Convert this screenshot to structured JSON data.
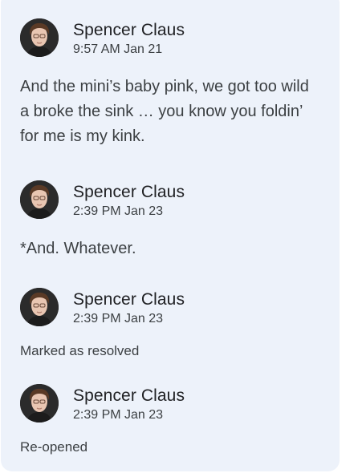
{
  "comments": [
    {
      "author": "Spencer Claus",
      "timestamp": "9:57 AM Jan 21",
      "body": "And the mini’s baby pink, we got too wild a broke the sink … you know you foldin’ for me is my kink."
    },
    {
      "author": "Spencer Claus",
      "timestamp": "2:39 PM Jan 23",
      "body": "*And. Whatever."
    },
    {
      "author": "Spencer Claus",
      "timestamp": "2:39 PM Jan 23",
      "status": "Marked as resolved"
    },
    {
      "author": "Spencer Claus",
      "timestamp": "2:39 PM Jan 23",
      "status": "Re-opened"
    }
  ],
  "colors": {
    "panel_background": "#edf2fa",
    "author_text": "#202124",
    "body_text": "#3c4043"
  }
}
